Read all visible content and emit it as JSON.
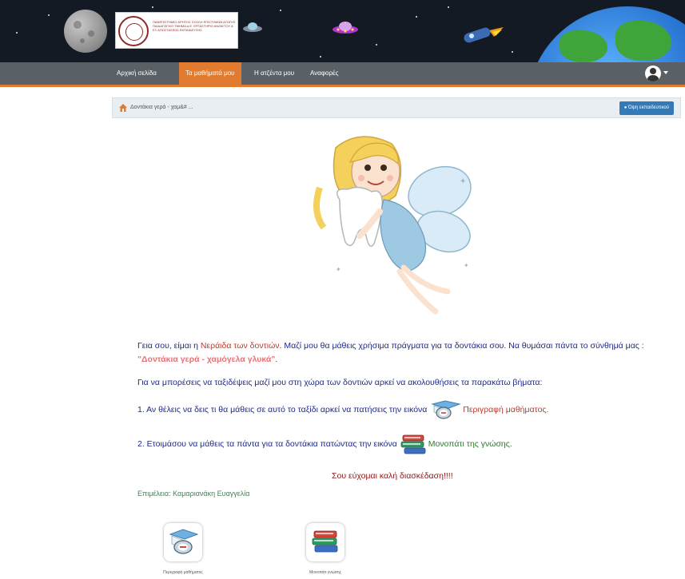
{
  "banner": {
    "logo_text": "ΠΑΝΕΠΙΣΤΗΜΙΟ ΚΡΗΤΗΣ ΣΧΟΛΗ ΕΠΙΣΤΗΜΩΝ ΑΓΩΓΗΣ ΠΑΙΔΑΓΩΓΙΚΟ ΤΜΗΜΑ Δ.Ε. ΕΡΓΑΣΤΗΡΙΟ ΑΝΟΙΚΤΟΥ & ΕΞ ΑΠΟΣΤΑΣΕΩΣ ΕΚΠΑΙΔΕΥΣΗΣ"
  },
  "nav": {
    "items": [
      {
        "label": "Αρχική σελίδα"
      },
      {
        "label": "Τα μαθήματά μου"
      },
      {
        "label": "Η ατζέντα μου"
      },
      {
        "label": "Αναφορές"
      }
    ]
  },
  "breadcrumb": {
    "text": "Δοντάκια γερά - χαμ&# ...",
    "teacher_view_label": "Όψη εκπαιδευτικού"
  },
  "content": {
    "intro_1": "Γεια σου, είμαι η ",
    "intro_fairy": "Νεράιδα των δοντιών",
    "intro_2": ". Μαζί μου θα μάθεις χρήσιμα πράγματα για τα δοντάκια σου. Να θυμάσαι πάντα το σύνθημά μας : ",
    "motto": "\"Δοντάκια γερά - χαμόγελα γλυκά\"",
    "intro_end": ".",
    "instructions": "Για να μπορέσεις να ταξιδέψεις μαζί μου στη χώρα των δοντιών αρκεί να ακολουθήσεις τα παρακάτω βήματα:",
    "step1_text": "1. Αν θέλεις να δεις τι θα μάθεις σε αυτό το ταξίδι αρκεί να πατήσεις την εικόνα",
    "step1_link": "Περιγραφή μαθήματος.",
    "step2_text": "2. Ετοιμάσου να μάθεις τα πάντα για τα δοντάκια πατώντας την εικόνα",
    "step2_link": "Μονοπάτι της γνώσης.",
    "wish": "Σου εύχομαι καλή διασκέδαση!!!!",
    "credit": "Επιμέλεια: Καμαριανάκη Ευαγγελία"
  },
  "tools": [
    {
      "label": "Περιγραφή μαθήματος"
    },
    {
      "label": "Μονοπάτι γνώσης"
    }
  ],
  "colors": {
    "accent": "#e07b2f",
    "navbar": "#5a6166",
    "text_blue": "#1d2a8a",
    "red": "#c0392b"
  }
}
